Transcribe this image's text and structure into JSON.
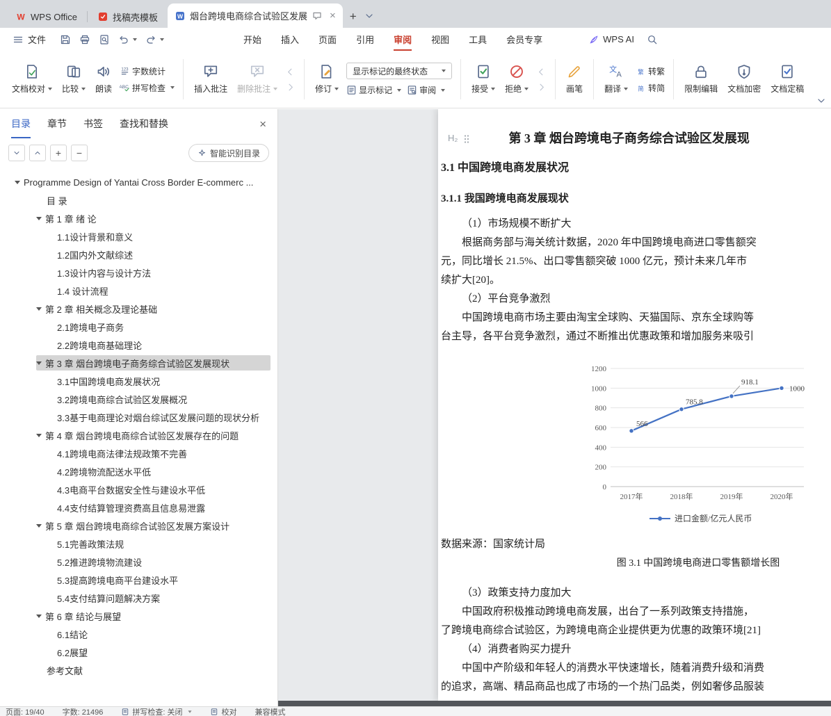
{
  "window": {
    "tabs": [
      {
        "label": "WPS Office"
      },
      {
        "label": "找稿壳模板"
      },
      {
        "label": "烟台跨境电商综合试验区发展"
      }
    ]
  },
  "menubar": {
    "file_label": "文件",
    "items": [
      {
        "label": "开始",
        "active": false
      },
      {
        "label": "插入",
        "active": false
      },
      {
        "label": "页面",
        "active": false
      },
      {
        "label": "引用",
        "active": false
      },
      {
        "label": "审阅",
        "active": true
      },
      {
        "label": "视图",
        "active": false
      },
      {
        "label": "工具",
        "active": false
      },
      {
        "label": "会员专享",
        "active": false
      }
    ],
    "wps_ai_label": "WPS AI"
  },
  "ribbon": {
    "groups": [
      [
        {
          "type": "big",
          "button": {
            "id": "doc-proofread",
            "label": "文档校对",
            "icon": "doc-proof",
            "caret": true
          }
        },
        {
          "type": "big",
          "button": {
            "id": "compare",
            "label": "比较",
            "icon": "compare",
            "caret": true
          }
        },
        {
          "type": "big",
          "button": {
            "id": "read-aloud",
            "label": "朗读",
            "icon": "speaker"
          }
        },
        {
          "type": "stack",
          "rows": [
            [
              {
                "id": "word-count",
                "label": "字数统计",
                "icon": "count"
              }
            ],
            [
              {
                "id": "spell-check",
                "label": "拼写检查",
                "icon": "spell",
                "caret": true
              }
            ]
          ]
        }
      ],
      [
        {
          "type": "big",
          "button": {
            "id": "insert-comment",
            "label": "插入批注",
            "icon": "comment-add"
          }
        },
        {
          "type": "big",
          "button": {
            "id": "delete-comment",
            "label": "删除批注",
            "icon": "comment-del",
            "caret": true,
            "disabled": true
          }
        },
        {
          "type": "stack",
          "rows": [
            [
              {
                "id": "prev-comment",
                "icon": "prev-arrow",
                "disabled": true
              }
            ],
            [
              {
                "id": "next-comment",
                "icon": "next-arrow",
                "disabled": true
              }
            ]
          ]
        }
      ],
      [
        {
          "type": "big",
          "button": {
            "id": "track-changes",
            "label": "修订",
            "icon": "revise",
            "caret": true
          }
        },
        {
          "type": "stack",
          "rows": [
            [
              {
                "id": "markup-state",
                "label": "显示标记的最终状态",
                "kind": "dropdown"
              }
            ],
            [
              {
                "id": "show-markup",
                "label": "显示标记",
                "icon": "show-markup",
                "caret": true
              },
              {
                "id": "review-pane",
                "label": "审阅",
                "icon": "review-pane",
                "caret": true
              }
            ]
          ]
        }
      ],
      [
        {
          "type": "big",
          "button": {
            "id": "accept-change",
            "label": "接受",
            "icon": "accept",
            "caret": true
          }
        },
        {
          "type": "big",
          "button": {
            "id": "reject-change",
            "label": "拒绝",
            "icon": "reject",
            "caret": true
          }
        },
        {
          "type": "stack",
          "rows": [
            [
              {
                "id": "prev-change",
                "icon": "prev-arrow",
                "disabled": true
              }
            ],
            [
              {
                "id": "next-change",
                "icon": "next-arrow",
                "disabled": true
              }
            ]
          ]
        }
      ],
      [
        {
          "type": "big",
          "button": {
            "id": "ink-pen",
            "label": "画笔",
            "icon": "pen"
          }
        }
      ],
      [
        {
          "type": "big",
          "button": {
            "id": "translate",
            "label": "翻译",
            "icon": "translate",
            "caret": true
          }
        },
        {
          "type": "stack",
          "rows": [
            [
              {
                "id": "to-traditional",
                "label": "转繁",
                "icon": "to-trad"
              }
            ],
            [
              {
                "id": "to-simplified",
                "label": "转简",
                "icon": "to-simp"
              }
            ]
          ]
        }
      ],
      [
        {
          "type": "big",
          "button": {
            "id": "restrict-editing",
            "label": "限制编辑",
            "icon": "restrict"
          }
        },
        {
          "type": "big",
          "button": {
            "id": "encrypt-document",
            "label": "文档加密",
            "icon": "encrypt"
          }
        },
        {
          "type": "big",
          "button": {
            "id": "finalize-document",
            "label": "文档定稿",
            "icon": "finalize"
          }
        }
      ]
    ]
  },
  "sidebar": {
    "tabs": [
      {
        "label": "目录",
        "active": true
      },
      {
        "label": "章节",
        "active": false
      },
      {
        "label": "书签",
        "active": false
      },
      {
        "label": "查找和替换",
        "active": false
      }
    ],
    "smart_button": "智能识别目录",
    "toc": [
      {
        "t": "Programme Design of Yantai Cross Border E-commerc ...",
        "l": 0,
        "tri": true
      },
      {
        "t": "目 录",
        "l": 1
      },
      {
        "t": "第 1 章 绪 论",
        "l": 1,
        "tri": true
      },
      {
        "t": "1.1设计背景和意义",
        "l": 2
      },
      {
        "t": "1.2国内外文献综述",
        "l": 2
      },
      {
        "t": "1.3设计内容与设计方法",
        "l": 2
      },
      {
        "t": "1.4 设计流程",
        "l": 2
      },
      {
        "t": "第 2 章 相关概念及理论基础",
        "l": 1,
        "tri": true
      },
      {
        "t": "2.1跨境电子商务",
        "l": 2
      },
      {
        "t": "2.2跨境电商基础理论",
        "l": 2
      },
      {
        "t": "第 3 章 烟台跨境电子商务综合试验区发展现状",
        "l": 1,
        "tri": true,
        "sel": true
      },
      {
        "t": "3.1中国跨境电商发展状况",
        "l": 2
      },
      {
        "t": "3.2跨境电商综合试验区发展概况",
        "l": 2
      },
      {
        "t": "3.3基于电商理论对烟台综试区发展问题的现状分析",
        "l": 2
      },
      {
        "t": "第 4 章 烟台跨境电商综合试验区发展存在的问题",
        "l": 1,
        "tri": true
      },
      {
        "t": "4.1跨境电商法律法规政策不完善",
        "l": 2
      },
      {
        "t": "4.2跨境物流配送水平低",
        "l": 2
      },
      {
        "t": "4.3电商平台数据安全性与建设水平低",
        "l": 2
      },
      {
        "t": "4.4支付结算管理资费高且信息易泄露",
        "l": 2
      },
      {
        "t": "第 5 章 烟台跨境电商综合试验区发展方案设计",
        "l": 1,
        "tri": true
      },
      {
        "t": "5.1完善政策法规",
        "l": 2
      },
      {
        "t": "5.2推进跨境物流建设",
        "l": 2
      },
      {
        "t": "5.3提高跨境电商平台建设水平",
        "l": 2
      },
      {
        "t": "5.4支付结算问题解决方案",
        "l": 2
      },
      {
        "t": "第 6 章 结论与展望",
        "l": 1,
        "tri": true
      },
      {
        "t": "6.1结论",
        "l": 2
      },
      {
        "t": "6.2展望",
        "l": 2
      },
      {
        "t": "参考文献",
        "l": 1
      }
    ]
  },
  "document": {
    "heading_badge": "H₂",
    "chapter_title": "第 3 章 烟台跨境电子商务综合试验区发展现",
    "sections": [
      {
        "type": "h2",
        "text": "3.1 中国跨境电商发展状况"
      },
      {
        "type": "h3",
        "text": "3.1.1 我国跨境电商发展现状"
      },
      {
        "type": "line",
        "indent": true,
        "text": "（1）市场规模不断扩大"
      },
      {
        "type": "line",
        "indent": true,
        "text": "根据商务部与海关统计数据，2020 年中国跨境电商进口零售额突"
      },
      {
        "type": "line",
        "text": "元，同比增长 21.5%、出口零售额突破 1000 亿元，预计未来几年市"
      },
      {
        "type": "line",
        "text": "续扩大[20]。"
      },
      {
        "type": "line",
        "indent": true,
        "text": "（2）平台竞争激烈"
      },
      {
        "type": "line",
        "indent": true,
        "text": "中国跨境电商市场主要由淘宝全球购、天猫国际、京东全球购等"
      },
      {
        "type": "line",
        "text": "台主导，各平台竞争激烈，通过不断推出优惠政策和增加服务来吸引"
      },
      {
        "type": "chart"
      },
      {
        "type": "line",
        "text": "数据来源：国家统计局"
      },
      {
        "type": "caption",
        "text": "图 3.1 中国跨境电商进口零售额增长图"
      },
      {
        "type": "line",
        "indent": true,
        "text": "（3）政策支持力度加大"
      },
      {
        "type": "line",
        "indent": true,
        "text": "中国政府积极推动跨境电商发展，出台了一系列政策支持措施，"
      },
      {
        "type": "line",
        "text": "了跨境电商综合试验区，为跨境电商企业提供更为优惠的政策环境[21]"
      },
      {
        "type": "line",
        "indent": true,
        "text": "（4）消费者购买力提升"
      },
      {
        "type": "line",
        "indent": true,
        "text": "中国中产阶级和年轻人的消费水平快速增长，随着消费升级和消费"
      },
      {
        "type": "line",
        "text": "的追求，高端、精品商品也成了市场的一个热门品类，例如奢侈品服装"
      }
    ]
  },
  "chart_data": {
    "type": "line",
    "title": "",
    "categories": [
      "2017年",
      "2018年",
      "2019年",
      "2020年"
    ],
    "series": [
      {
        "name": "进口金额/亿元人民币",
        "values": [
          566,
          785.8,
          918.1,
          1000
        ],
        "color": "#4472c4"
      }
    ],
    "data_labels": [
      "566",
      "785.8",
      "918.1",
      "1000"
    ],
    "ylim": [
      0,
      1200
    ],
    "ytick_step": 200,
    "grid": true,
    "legend_position": "bottom"
  },
  "statusbar": {
    "items": [
      {
        "label": "页面: 19/40"
      },
      {
        "label": "字数: 21496"
      },
      {
        "label": "拼写检查: 关闭",
        "icon": "status-doc",
        "caret": true
      },
      {
        "label": "校对",
        "icon": "status-doc"
      },
      {
        "label": "兼容模式"
      }
    ]
  }
}
